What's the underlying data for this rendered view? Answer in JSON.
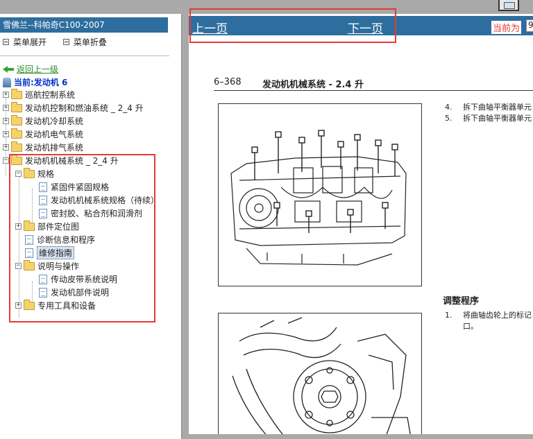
{
  "left": {
    "title": "雪佛兰--科帕奇C100-2007",
    "menu": {
      "expand": "菜单展开",
      "collapse": "菜单折叠"
    },
    "tree": {
      "back": "返回上一级",
      "current": "当前:发动机 6",
      "items": [
        "巡航控制系统",
        "发动机控制和燃油系统 _ 2_4 升",
        "发动机冷却系统",
        "发动机电气系统",
        "发动机排气系统",
        "发动机机械系统 _ 2_4 升",
        "规格",
        "紧固件紧固规格",
        "发动机机械系统规格（待续）",
        "密封胶、粘合剂和润滑剂",
        "部件定位图",
        "诊断信息和程序",
        "维修指南",
        "说明与操作",
        "传动皮带系统说明",
        "发动机部件说明",
        "专用工具和设备"
      ]
    }
  },
  "right": {
    "nav": {
      "prev": "上一页",
      "next": "下一页",
      "current_label": "当前为",
      "page_value": "9"
    },
    "doc": {
      "page_no": "6–368",
      "title": "发动机机械系统 - 2.4 升",
      "steps_top": [
        {
          "n": "4.",
          "text": "拆下曲轴平衡器单元"
        },
        {
          "n": "5.",
          "text": "拆下曲轴平衡器单元"
        }
      ],
      "subhead": "调整程序",
      "steps_bottom": [
        {
          "n": "1.",
          "text": "将曲轴齿轮上的标记"
        },
        {
          "n": "",
          "text": "口。"
        }
      ]
    }
  },
  "colors": {
    "title_bar": "#2e6e9e",
    "highlight_box": "#e53935",
    "link_green": "#2c8a2c",
    "current_blue": "#0033cc"
  }
}
